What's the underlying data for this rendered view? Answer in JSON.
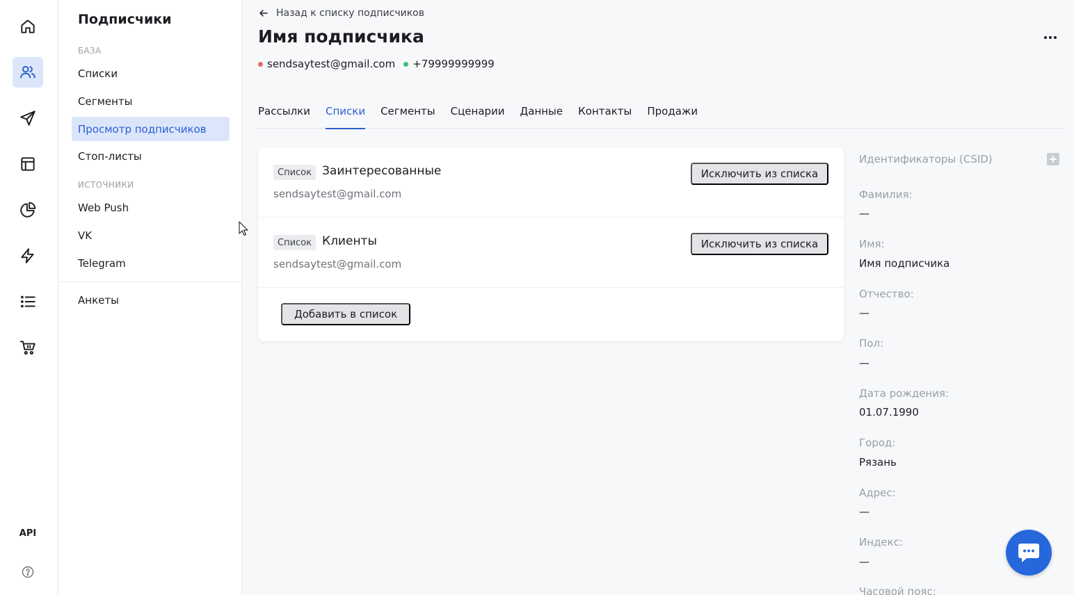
{
  "rail": {
    "icons": [
      "home-icon",
      "users-icon",
      "send-icon",
      "layout-icon",
      "pie-chart-icon",
      "lightning-icon",
      "list-icon",
      "cart-icon"
    ],
    "active": "users-icon",
    "api_label": "API",
    "help_icon": "help-icon"
  },
  "subnav": {
    "title": "Подписчики",
    "group_base": "БАЗА",
    "items_base": [
      "Списки",
      "Сегменты",
      "Просмотр подписчиков",
      "Стоп-листы"
    ],
    "active_item": "Просмотр подписчиков",
    "group_sources": "ИСТОЧНИКИ",
    "items_sources": [
      "Web Push",
      "VK",
      "Telegram"
    ],
    "item_forms": "Анкеты"
  },
  "header": {
    "back_label": "Назад к списку подписчиков",
    "title": "Имя подписчика",
    "email": "sendsaytest@gmail.com",
    "phone": "+79999999999"
  },
  "tabs": [
    "Рассылки",
    "Списки",
    "Сегменты",
    "Сценарии",
    "Данные",
    "Контакты",
    "Продажи"
  ],
  "active_tab": "Списки",
  "lists": [
    {
      "badge": "Список",
      "name": "Заинтересованные",
      "email": "sendsaytest@gmail.com",
      "action": "Исключить из списка"
    },
    {
      "badge": "Список",
      "name": "Клиенты",
      "email": "sendsaytest@gmail.com",
      "action": "Исключить из списка"
    }
  ],
  "add_to_list": "Добавить в список",
  "profile": {
    "csid_label": "Идентификаторы (CSID)",
    "fields": [
      {
        "label": "Фамилия:",
        "value": "—"
      },
      {
        "label": "Имя:",
        "value": "Имя подписчика"
      },
      {
        "label": "Отчество:",
        "value": "—"
      },
      {
        "label": "Пол:",
        "value": "—"
      },
      {
        "label": "Дата рождения:",
        "value": "01.07.1990"
      },
      {
        "label": "Город:",
        "value": "Рязань"
      },
      {
        "label": "Адрес:",
        "value": "—"
      },
      {
        "label": "Индекс:",
        "value": "—"
      }
    ],
    "last_label": "Часовой пояс:"
  },
  "colors": {
    "accent": "#2a5fd0",
    "active_bg": "#dce6fb",
    "email_dot": "#e56a6a",
    "phone_dot": "#3fbf73",
    "chat_bg": "#2667dc"
  }
}
